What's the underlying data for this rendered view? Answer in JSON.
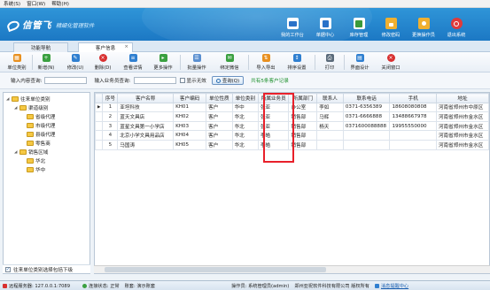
{
  "menubar": [
    "系统(S)",
    "窗口(W)",
    "帮助(H)"
  ],
  "app": {
    "brand": "信管飞",
    "slogan": "精细化管理软件"
  },
  "topnav": [
    {
      "label": "我的工作台",
      "icon": "monitor-icon",
      "color": "#2a72c8"
    },
    {
      "label": "单据中心",
      "icon": "document-icon",
      "color": "#2a72c8"
    },
    {
      "label": "库存管理",
      "icon": "inventory-icon",
      "color": "#3a9a3a"
    },
    {
      "label": "修改密码",
      "icon": "lock-icon",
      "color": "#e8a020"
    },
    {
      "label": "更换操作员",
      "icon": "user-switch-icon",
      "color": "#e8a020"
    },
    {
      "label": "退出系统",
      "icon": "power-icon",
      "color": "#d83030"
    }
  ],
  "tabs": [
    {
      "label": "功能导航"
    },
    {
      "label": "客户信息"
    }
  ],
  "toolbar": [
    {
      "label": "单位类别",
      "icon": "category-icon",
      "color": "#e89020",
      "glyph": "▦"
    },
    {
      "label": "新增(N)",
      "icon": "add-icon",
      "color": "#3aa040",
      "glyph": "+"
    },
    {
      "label": "修改(U)",
      "icon": "edit-icon",
      "color": "#2f7fd0",
      "glyph": "✎"
    },
    {
      "label": "删除(D)",
      "icon": "delete-icon",
      "color": "#d83030",
      "glyph": "×"
    },
    {
      "label": "查看详情",
      "icon": "details-icon",
      "color": "#2f7fd0",
      "glyph": "≡"
    },
    {
      "label": "更多操作",
      "icon": "more-icon",
      "color": "#3aa040",
      "glyph": "▸"
    },
    {
      "label": "批量操作",
      "icon": "batch-icon",
      "color": "#5a8fd0",
      "glyph": "☰"
    },
    {
      "label": "绑定微信",
      "icon": "wechat-icon",
      "color": "#3aa040",
      "glyph": "✉"
    },
    {
      "label": "导入导出",
      "icon": "import-export-icon",
      "color": "#e89020",
      "glyph": "⇅"
    },
    {
      "label": "排序设置",
      "icon": "sort-icon",
      "color": "#2f7fd0",
      "glyph": "↕"
    },
    {
      "label": "打印",
      "icon": "print-icon",
      "color": "#5a6a7a",
      "glyph": "⎙"
    },
    {
      "label": "界面设计",
      "icon": "layout-icon",
      "color": "#2f7fd0",
      "glyph": "▤"
    },
    {
      "label": "关闭窗口",
      "icon": "close-window-icon",
      "color": "#d83030",
      "glyph": "×"
    }
  ],
  "filter": {
    "search_label": "输入内容查询:",
    "search_value": "",
    "sales_label": "输入业务员查询:",
    "sales_value": "",
    "show_invalid": "显示无效",
    "query_button": "查询(Q)",
    "summary": "共有5条客户记录"
  },
  "tree": {
    "root": "往来单位类别",
    "groups": [
      {
        "label": "渠道级别",
        "children": [
          "省级代理",
          "市级代理",
          "县级代理",
          "零售商"
        ]
      },
      {
        "label": "销售区域",
        "children": [
          "华北",
          "华中"
        ]
      }
    ],
    "footer": "往来单位类别选择包括下级"
  },
  "table": {
    "columns": [
      "序号",
      "客户名称",
      "客户编码",
      "单位性质",
      "单位类别",
      "所属业务员",
      "所属部门",
      "联系人",
      "联系电话",
      "手机",
      "地址"
    ],
    "rows": [
      [
        "1",
        "亚坦科技",
        "KH01",
        "客户",
        "华中",
        "张亚",
        "办公室",
        "李如",
        "0371-6356389",
        "18608080808",
        "河南省郑州市中原区"
      ],
      [
        "2",
        "蓝天文具店",
        "KH02",
        "客户",
        "华北",
        "张亚",
        "销售部",
        "马辉",
        "0371-6666888",
        "13488667978",
        "河南省郑州市金水区"
      ],
      [
        "3",
        "蓝星文具第一小学店",
        "KH03",
        "客户",
        "华北",
        "张亚",
        "销售部",
        "杨天",
        "0371600088888",
        "19955550000",
        "河南省郑州市金水区"
      ],
      [
        "4",
        "北京小学文具用品店",
        "KH04",
        "客户",
        "华北",
        "李皓",
        "销售部",
        "",
        "",
        "",
        "河南省郑州市金水区"
      ],
      [
        "5",
        "马国涛",
        "KH05",
        "客户",
        "华北",
        "李皓",
        "销售部",
        "",
        "",
        "",
        "河南省郑州市金水区"
      ]
    ]
  },
  "status": {
    "server": "远程服务器: 127.0.0.1:7089",
    "connection": "连接状态: 正常",
    "account": "账套: 演示账套",
    "operator": "操作员: 系统管理员(admin)",
    "company": "郑州亚祝软件科技有限公司 版权所有",
    "message": "消息提醒中心"
  }
}
